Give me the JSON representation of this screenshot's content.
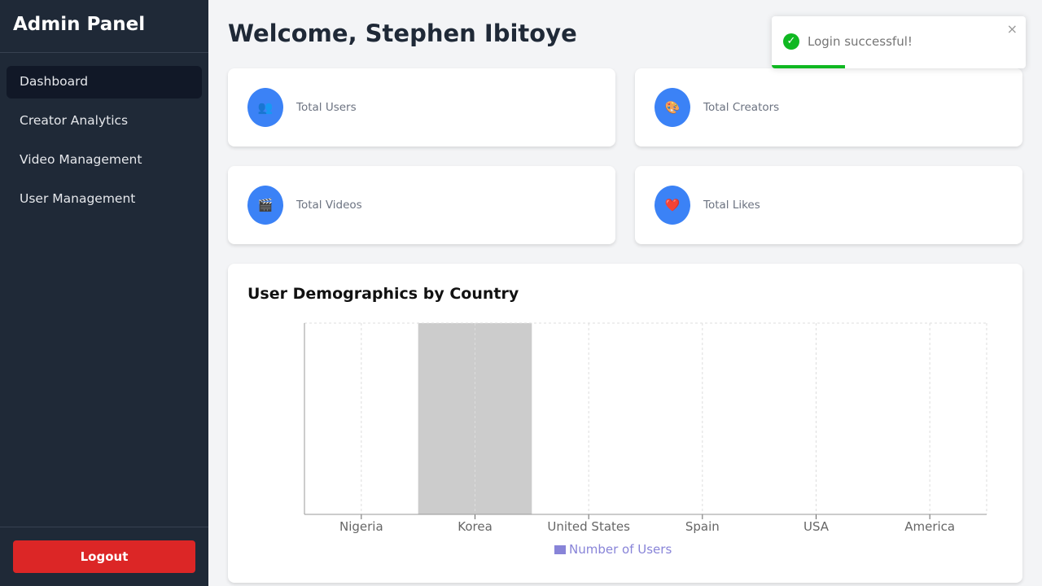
{
  "sidebar": {
    "title": "Admin Panel",
    "items": [
      {
        "label": "Dashboard",
        "active": true
      },
      {
        "label": "Creator Analytics"
      },
      {
        "label": "Video Management"
      },
      {
        "label": "User Management"
      }
    ],
    "logout": "Logout"
  },
  "header": {
    "welcome": "Welcome, Stephen Ibitoye"
  },
  "stats": [
    {
      "label": "Total Users",
      "icon": "users-icon",
      "emoji": "👥"
    },
    {
      "label": "Total Creators",
      "icon": "palette-icon",
      "emoji": "🎨"
    },
    {
      "label": "Total Videos",
      "icon": "clapper-icon",
      "emoji": "🎬"
    },
    {
      "label": "Total Likes",
      "icon": "heart-icon",
      "emoji": "❤️"
    }
  ],
  "toast": {
    "message": "Login successful!",
    "close": "×",
    "progress": 0.29,
    "color": "#0fb821"
  },
  "chart_data": {
    "type": "bar",
    "title": "User Demographics by Country",
    "categories": [
      "Nigeria",
      "Korea",
      "United States",
      "Spain",
      "USA",
      "America"
    ],
    "series": [
      {
        "name": "Number of Users",
        "color": "#8884d8",
        "values": [
          null,
          null,
          null,
          null,
          null,
          null
        ]
      }
    ],
    "highlighted_category": "Korea",
    "grid": true,
    "legend": "bottom"
  }
}
